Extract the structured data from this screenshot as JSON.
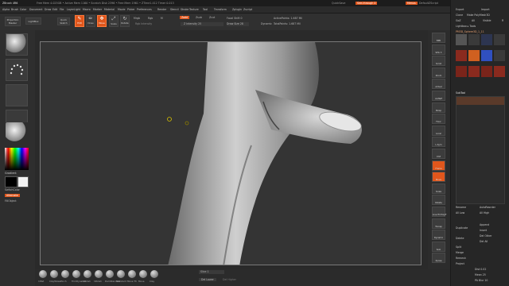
{
  "titlebar": {
    "app": "ZBrush 4R6",
    "status": "Free Mem 4.025GB • Active Mem 1160 • Scratch Disk 2396 • Free Mem 1961 • ZTime1.412 Timer 0.013",
    "quicksave": "QuickSave",
    "seethrough": "See-through 0",
    "menus": "Menus",
    "script": "DefaultZScript"
  },
  "menubar": {
    "items": [
      "Alpha",
      "Brush",
      "Color",
      "Document",
      "Draw",
      "Edit",
      "File",
      "Layer",
      "Light",
      "Macro",
      "Marker",
      "Material",
      "Movie",
      "Picker",
      "Preferences",
      "Render",
      "Stencil",
      "Stroke",
      "Texture",
      "Tool",
      "Transform",
      "Zplugin",
      "Zscript"
    ]
  },
  "toptools": {
    "projection": "Projection Master",
    "lightbox": "LightBox",
    "quicksketch": "Quick Sketch",
    "edit": "Edit",
    "draw": "Draw",
    "move": "Move",
    "scale": "Scale",
    "rotate": "Rotate",
    "mrgb": "Mrgb",
    "rgb": "Rgb",
    "m": "M",
    "rgb_intensity": "Rgb Intensity",
    "zadd": "Zadd",
    "zsub": "Zsub",
    "zcut": "Zcut",
    "z_intensity": "Z Intensity 25",
    "focal_shift": "Focal Shift 0",
    "draw_size": "Draw Size 28",
    "dynamic": "Dynamic",
    "active_points": "ActivePoints: 1.687 Mil",
    "total_points": "TotalPoints: 1.687 Mil"
  },
  "leftshelf": {
    "gradient": "Gradient",
    "switchcolor": "SwitchColor",
    "alternate": "Alternate",
    "fillobject": "FillObject"
  },
  "bottombar": {
    "brushes": [
      "Inflat",
      "ClayTubes",
      "Pinch",
      "TrimDynamic",
      "hPolish",
      "hPolish",
      "DamStandard",
      "Standard",
      "Move Th",
      "Move",
      "Clay"
    ],
    "slice": "Slice 1",
    "dellower": "Del Lower",
    "delhigher": "Del Higher"
  },
  "rightshelf": {
    "items": [
      "BPR",
      "SPix 3",
      "Scroll",
      "Zoom",
      "Actual",
      "AAHalf",
      "Persp",
      "Floor",
      "Local",
      "L.Sym",
      "XYZ",
      "Frame",
      "Move",
      "Scale",
      "Rotate",
      "Line Fill PolyF",
      "Transp",
      "Dynamic",
      "Solo",
      "Xpose"
    ]
  },
  "tray": {
    "export": "Export",
    "import": "Import",
    "clone": "Clone",
    "make_polymesh": "Make PolyMesh3D",
    "goz": "GoZ",
    "all": "All",
    "visible": "Visible",
    "r": "R",
    "lightbox_tools": "Lightbox ▸ Tools",
    "current_tool": "PM3D_Sphere3D_1_11",
    "subtool": "SubTool",
    "rename": "Rename",
    "autoreorder": "AutoReorder",
    "all_low": "All Low",
    "all_high": "All High",
    "duplicate": "Duplicate",
    "append": "Append",
    "insert": "Insert",
    "delete": "Delete",
    "del_other": "Del Other",
    "del_all": "Del All",
    "split": "Split",
    "merge": "Merge",
    "remesh": "Remesh",
    "project": "Project",
    "dist": "Dist 0.02",
    "mean": "Mean 25",
    "pa_blur": "PA Blur 10"
  }
}
